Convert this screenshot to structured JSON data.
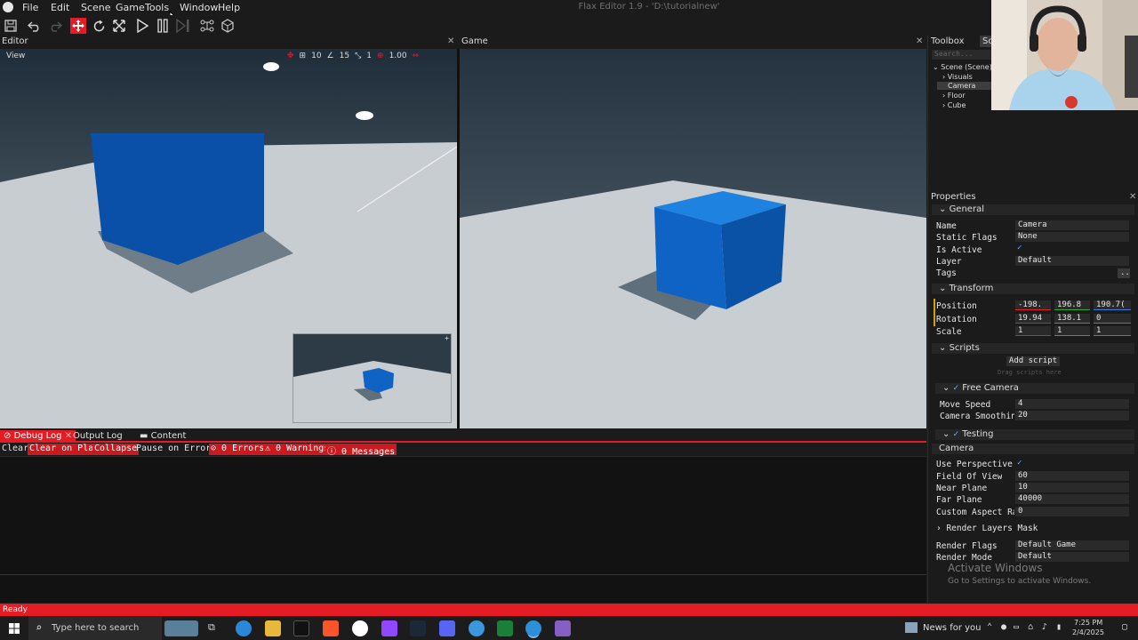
{
  "app": {
    "title": "Flax Editor 1.9 - 'D:\\tutorialnew'",
    "menu": [
      "File",
      "Edit",
      "Scene",
      "Game",
      "Tools",
      "Window",
      "Help"
    ],
    "toolbar_icons": [
      "save-icon",
      "undo-icon",
      "redo-icon",
      "translate-gizmo-icon",
      "rotate-gizmo-icon",
      "scale-gizmo-icon",
      "play-icon",
      "pause-icon",
      "step-icon",
      "snap-icon",
      "build-icon"
    ]
  },
  "editor": {
    "tab": "Editor",
    "view_label": "View",
    "stats": [
      "10",
      "15",
      "1",
      "1.00"
    ]
  },
  "game": {
    "tab": "Game"
  },
  "colors": {
    "accent": "#e51c23",
    "sky_top": "#253240",
    "sky_bottom": "#5f6e78",
    "floor": "#c9ced2",
    "cube": "#0b5fc0"
  },
  "debug": {
    "tabs": [
      "Debug Log",
      "Output Log",
      "Content"
    ],
    "buttons": [
      "Clear",
      "Clear on Play",
      "Collapse",
      "Pause on Error"
    ],
    "counts": [
      "0 Errors",
      "0 Warnings",
      "0 Messages"
    ]
  },
  "right": {
    "tabs": [
      "Toolbox",
      "Sc"
    ],
    "search_placeholder": "Search...",
    "tree": [
      "Scene (Scene)",
      "Visuals",
      "Camera",
      "Floor",
      "Cube"
    ]
  },
  "properties": {
    "title": "Properties",
    "general": {
      "header": "General",
      "rows": [
        {
          "label": "Name",
          "value": "Camera"
        },
        {
          "label": "Static Flags",
          "value": "None"
        },
        {
          "label": "Is Active",
          "value": "✓"
        },
        {
          "label": "Layer",
          "value": "Default"
        },
        {
          "label": "Tags",
          "value": "..."
        }
      ]
    },
    "transform": {
      "header": "Transform",
      "position": {
        "label": "Position",
        "x": "-198.",
        "y": "196.8",
        "z": "190.7("
      },
      "rotation": {
        "label": "Rotation",
        "x": "19.94",
        "y": "138.1",
        "z": "0"
      },
      "scale": {
        "label": "Scale",
        "x": "1",
        "y": "1",
        "z": "1"
      }
    },
    "scripts": {
      "header": "Scripts",
      "add_label": "Add script",
      "drag_hint": "Drag scripts here",
      "free_camera": {
        "header": "Free Camera",
        "rows": [
          {
            "label": "Move Speed",
            "value": "4"
          },
          {
            "label": "Camera Smoothing",
            "value": "20"
          }
        ]
      },
      "testing": "Testing"
    },
    "camera": {
      "header": "Camera",
      "rows": [
        {
          "label": "Use Perspective",
          "value": "✓"
        },
        {
          "label": "Field Of View",
          "value": "60"
        },
        {
          "label": "Near Plane",
          "value": "10"
        },
        {
          "label": "Far Plane",
          "value": "40000"
        },
        {
          "label": "Custom Aspect Ra",
          "value": "0"
        }
      ],
      "render_layers": "Render Layers Mask",
      "render_rows": [
        {
          "label": "Render Flags",
          "value": "Default Game"
        },
        {
          "label": "Render Mode",
          "value": "Default"
        }
      ]
    }
  },
  "watermark": {
    "line1": "Activate Windows",
    "line2": "Go to Settings to activate Windows."
  },
  "status": "Ready",
  "taskbar": {
    "search_placeholder": "Type here to search",
    "news": "News for you",
    "time": "7:25 PM",
    "date": "2/4/2025"
  }
}
